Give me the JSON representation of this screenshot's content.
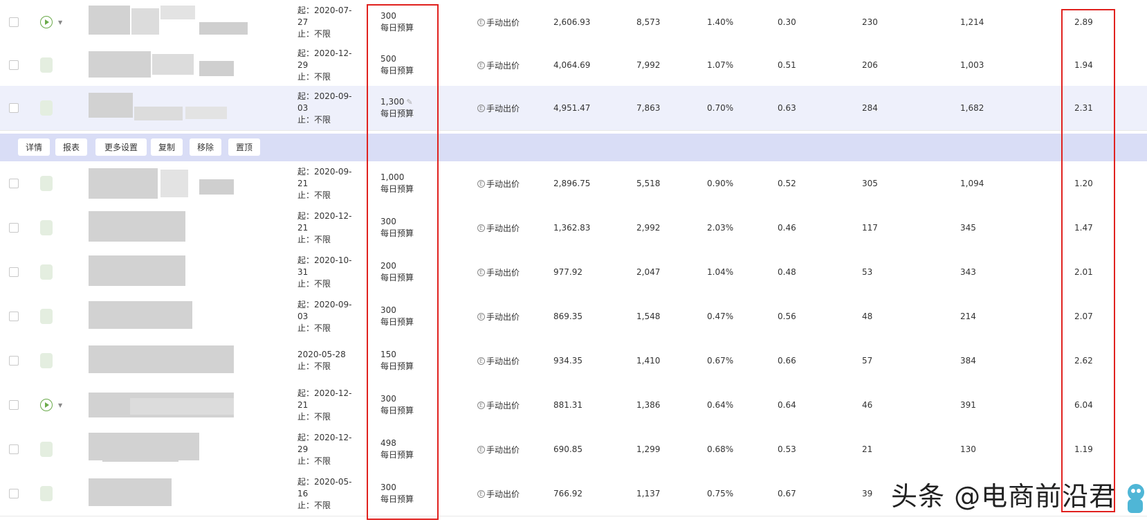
{
  "actions": [
    "详情",
    "报表",
    "更多设置",
    "复制",
    "移除",
    "置顶"
  ],
  "status_kinds": [
    "play",
    "blob",
    "blob",
    "blob",
    "blob",
    "blob",
    "blob",
    "blob",
    "play",
    "blob",
    "blob"
  ],
  "rows": [
    {
      "start": "起：2020-07-27",
      "end": "止：不限",
      "budget": "300",
      "budget_label": "每日预算",
      "bid": "手动出价",
      "spend": "2,606.93",
      "impressions": "8,573",
      "ctr": "1.40%",
      "cpc": "0.30",
      "orders": "230",
      "clicks": "1,214",
      "roi": "2.89"
    },
    {
      "start": "起：2020-12-29",
      "end": "止：不限",
      "budget": "500",
      "budget_label": "每日预算",
      "bid": "手动出价",
      "spend": "4,064.69",
      "impressions": "7,992",
      "ctr": "1.07%",
      "cpc": "0.51",
      "orders": "206",
      "clicks": "1,003",
      "roi": "1.94"
    },
    {
      "start": "起：2020-09-03",
      "end": "止：不限",
      "budget": "1,300",
      "budget_label": "每日预算",
      "bid": "手动出价",
      "spend": "4,951.47",
      "impressions": "7,863",
      "ctr": "0.70%",
      "cpc": "0.63",
      "orders": "284",
      "clicks": "1,682",
      "roi": "2.31"
    },
    {
      "start": "起：2020-09-21",
      "end": "止：不限",
      "budget": "1,000",
      "budget_label": "每日预算",
      "bid": "手动出价",
      "spend": "2,896.75",
      "impressions": "5,518",
      "ctr": "0.90%",
      "cpc": "0.52",
      "orders": "305",
      "clicks": "1,094",
      "roi": "1.20"
    },
    {
      "start": "起：2020-12-21",
      "end": "止：不限",
      "budget": "300",
      "budget_label": "每日预算",
      "bid": "手动出价",
      "spend": "1,362.83",
      "impressions": "2,992",
      "ctr": "2.03%",
      "cpc": "0.46",
      "orders": "117",
      "clicks": "345",
      "roi": "1.47"
    },
    {
      "start": "起：2020-10-31",
      "end": "止：不限",
      "budget": "200",
      "budget_label": "每日预算",
      "bid": "手动出价",
      "spend": "977.92",
      "impressions": "2,047",
      "ctr": "1.04%",
      "cpc": "0.48",
      "orders": "53",
      "clicks": "343",
      "roi": "2.01"
    },
    {
      "start": "起：2020-09-03",
      "end": "止：不限",
      "budget": "300",
      "budget_label": "每日预算",
      "bid": "手动出价",
      "spend": "869.35",
      "impressions": "1,548",
      "ctr": "0.47%",
      "cpc": "0.56",
      "orders": "48",
      "clicks": "214",
      "roi": "2.07"
    },
    {
      "start": "2020-05-28",
      "end": "止：不限",
      "budget": "150",
      "budget_label": "每日预算",
      "bid": "手动出价",
      "spend": "934.35",
      "impressions": "1,410",
      "ctr": "0.67%",
      "cpc": "0.66",
      "orders": "57",
      "clicks": "384",
      "roi": "2.62"
    },
    {
      "start": "起：2020-12-21",
      "end": "止：不限",
      "budget": "300",
      "budget_label": "每日预算",
      "bid": "手动出价",
      "spend": "881.31",
      "impressions": "1,386",
      "ctr": "0.64%",
      "cpc": "0.64",
      "orders": "46",
      "clicks": "391",
      "roi": "6.04"
    },
    {
      "start": "起：2020-12-29",
      "end": "止：不限",
      "budget": "498",
      "budget_label": "每日预算",
      "bid": "手动出价",
      "spend": "690.85",
      "impressions": "1,299",
      "ctr": "0.68%",
      "cpc": "0.53",
      "orders": "21",
      "clicks": "130",
      "roi": "1.19"
    },
    {
      "start": "起：2020-05-16",
      "end": "止：不限",
      "budget": "300",
      "budget_label": "每日预算",
      "bid": "手动出价",
      "spend": "766.92",
      "impressions": "1,137",
      "ctr": "0.75%",
      "cpc": "0.67",
      "orders": "39",
      "clicks": "",
      "roi": ""
    }
  ],
  "watermark": "头条 @电商前沿君",
  "colors": {
    "highlight_box": "#e0211e",
    "action_bar": "#d9ddf6",
    "status_green": "#6aaa4a"
  }
}
